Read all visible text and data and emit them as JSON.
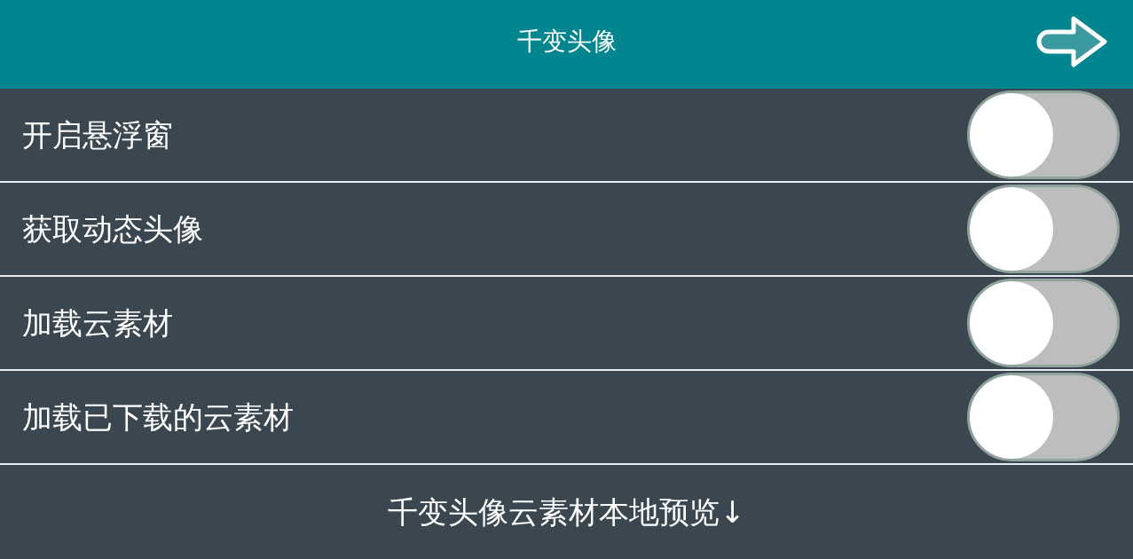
{
  "header": {
    "title": "千变头像"
  },
  "settings": [
    {
      "label": "开启悬浮窗",
      "on": false
    },
    {
      "label": "获取动态头像",
      "on": false
    },
    {
      "label": "加载云素材",
      "on": false
    },
    {
      "label": "加载已下载的云素材",
      "on": false
    }
  ],
  "footer": {
    "link": "千变头像云素材本地预览↓"
  }
}
